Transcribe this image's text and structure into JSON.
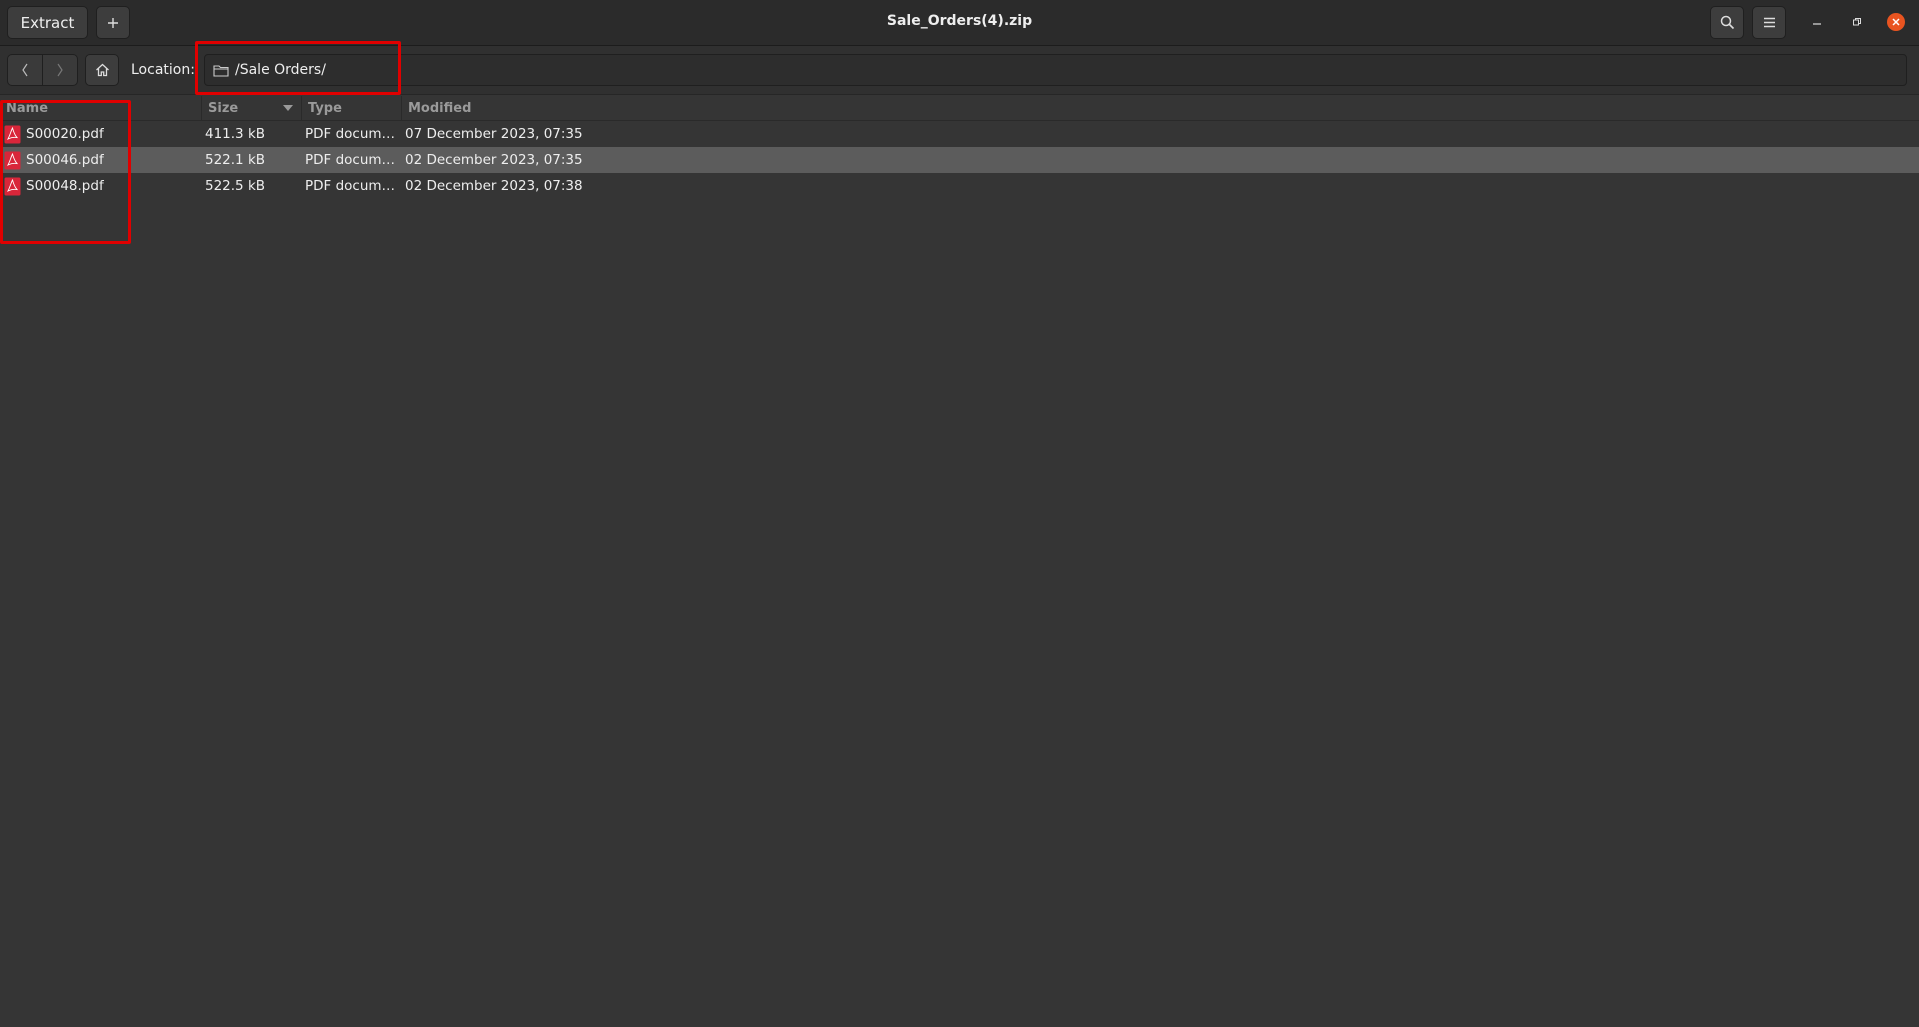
{
  "window": {
    "title": "Sale_Orders(4).zip"
  },
  "toolbar": {
    "extract_label": "Extract",
    "add_icon": "plus-icon",
    "search_icon": "search-icon",
    "menu_icon": "hamburger-menu-icon",
    "minimize_icon": "minimize-icon",
    "maximize_icon": "restore-icon",
    "close_icon": "close-icon"
  },
  "location_bar": {
    "back_icon": "chevron-left-icon",
    "forward_icon": "chevron-right-icon",
    "home_icon": "home-icon",
    "label": "Location:",
    "path": "/Sale Orders/",
    "folder_icon": "folder-icon"
  },
  "file_list": {
    "columns": {
      "name": "Name",
      "size": "Size",
      "type": "Type",
      "modified": "Modified"
    },
    "sort_column": "Size",
    "sort_direction": "descending",
    "rows": [
      {
        "name": "S00020.pdf",
        "size": "411.3 kB",
        "type": "PDF docum…",
        "modified": "07 December 2023, 07:35",
        "selected": false,
        "icon": "pdf-icon"
      },
      {
        "name": "S00046.pdf",
        "size": "522.1 kB",
        "type": "PDF docum…",
        "modified": "02 December 2023, 07:35",
        "selected": true,
        "icon": "pdf-icon"
      },
      {
        "name": "S00048.pdf",
        "size": "522.5 kB",
        "type": "PDF docum…",
        "modified": "02 December 2023, 07:38",
        "selected": false,
        "icon": "pdf-icon"
      }
    ]
  },
  "colors": {
    "accent_close": "#e95420",
    "annotation": "#e00000",
    "pdf_icon": "#d9263a",
    "selection": "#5c5c5c"
  }
}
